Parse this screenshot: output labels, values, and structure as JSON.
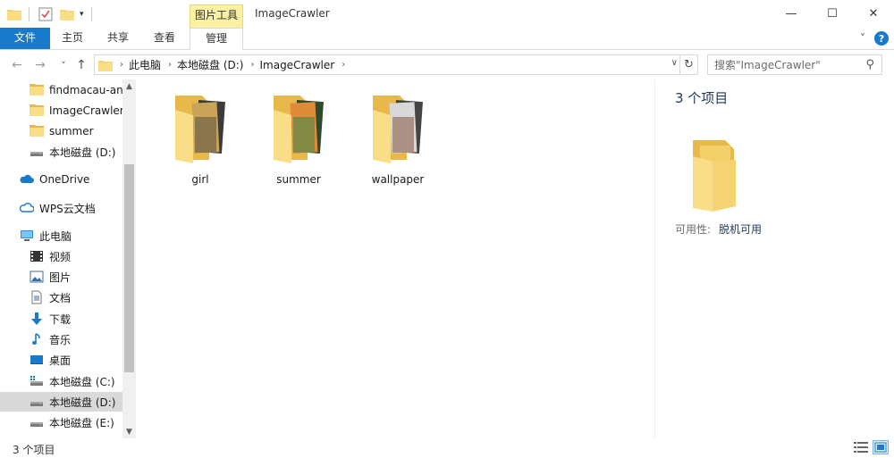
{
  "window": {
    "title": "ImageCrawler",
    "context_group": "图片工具",
    "minimize_glyph": "—",
    "maximize_glyph": "☐",
    "close_glyph": "✕"
  },
  "ribbon": {
    "tabs": [
      "文件",
      "主页",
      "共享",
      "查看",
      "管理"
    ],
    "collapse_glyph": "˅",
    "help_glyph": "?"
  },
  "nav": {
    "back_glyph": "←",
    "forward_glyph": "→",
    "recent_glyph": "˅",
    "up_glyph": "↑",
    "breadcrumb": [
      "此电脑",
      "本地磁盘 (D:)",
      "ImageCrawler"
    ],
    "search_placeholder": "搜索\"ImageCrawler\""
  },
  "sidebar": {
    "items": [
      {
        "label": "findmacau-and",
        "icon": "folder-icon"
      },
      {
        "label": "ImageCrawler",
        "icon": "folder-icon"
      },
      {
        "label": "summer",
        "icon": "folder-icon"
      },
      {
        "label": "本地磁盘 (D:)",
        "icon": "drive-icon"
      },
      {
        "label": "OneDrive",
        "icon": "cloud-icon"
      },
      {
        "label": "WPS云文档",
        "icon": "wps-cloud-icon"
      },
      {
        "label": "此电脑",
        "icon": "computer-icon"
      },
      {
        "label": "视频",
        "icon": "video-icon"
      },
      {
        "label": "图片",
        "icon": "pictures-icon"
      },
      {
        "label": "文档",
        "icon": "documents-icon"
      },
      {
        "label": "下载",
        "icon": "download-icon"
      },
      {
        "label": "音乐",
        "icon": "music-icon"
      },
      {
        "label": "桌面",
        "icon": "desktop-icon"
      },
      {
        "label": "本地磁盘 (C:)",
        "icon": "system-drive-icon"
      },
      {
        "label": "本地磁盘 (D:)",
        "icon": "drive-icon"
      },
      {
        "label": "本地磁盘 (E:)",
        "icon": "drive-icon"
      }
    ],
    "selected_index": 14
  },
  "files": [
    {
      "name": "girl",
      "icon": "folder-thumbnail-icon"
    },
    {
      "name": "summer",
      "icon": "folder-thumbnail-icon"
    },
    {
      "name": "wallpaper",
      "icon": "folder-thumbnail-icon"
    }
  ],
  "details": {
    "title": "3 个项目",
    "availability_label": "可用性:",
    "availability_value": "脱机可用"
  },
  "status": {
    "item_count": "3 个项目"
  },
  "colors": {
    "accent": "#1979ca",
    "context_tab": "#fcf0a3",
    "folder": "#f5d372",
    "selection": "#d9d9d9"
  }
}
